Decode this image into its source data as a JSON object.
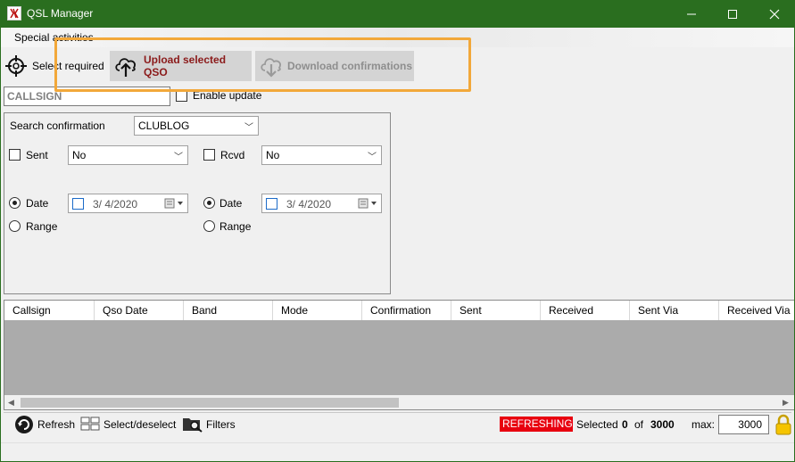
{
  "window": {
    "title": "QSL Manager",
    "minimize": "—",
    "maximize": "☐",
    "close": "✕"
  },
  "menu": {
    "items": [
      "Special activities"
    ]
  },
  "toolbar": {
    "select_required": "Select required",
    "upload": "Upload selected QSO",
    "download": "Download confirmations"
  },
  "callsign": {
    "value": "CALLSIGN"
  },
  "enable_update": {
    "label": "Enable update",
    "checked": false
  },
  "search": {
    "label": "Search confirmation",
    "value": "CLUBLOG",
    "sent": {
      "label": "Sent",
      "value": "No",
      "checked": false
    },
    "rcvd": {
      "label": "Rcvd",
      "value": "No",
      "checked": false
    },
    "left": {
      "date_label": "Date",
      "range_label": "Range",
      "date_value": "3/  4/2020",
      "selected": "Date"
    },
    "right": {
      "date_label": "Date",
      "range_label": "Range",
      "date_value": "3/  4/2020",
      "selected": "Date"
    }
  },
  "grid": {
    "columns": [
      "Callsign",
      "Qso Date",
      "Band",
      "Mode",
      "Confirmation",
      "Sent",
      "Received",
      "Sent Via",
      "Received Via"
    ]
  },
  "status": {
    "refresh": "Refresh",
    "select_deselect": "Select/deselect",
    "filters": "Filters",
    "refreshing": "REFRESHING...",
    "selected_label": "Selected",
    "selected_count": "0",
    "of_label": "of",
    "total": "3000",
    "max_label": "max:",
    "max_value": "3000"
  },
  "colors": {
    "titlebar": "#2a6e1f",
    "highlight": "#f2a83a",
    "upload_text": "#8b1a1a",
    "refreshing_bg": "#e8000f"
  }
}
